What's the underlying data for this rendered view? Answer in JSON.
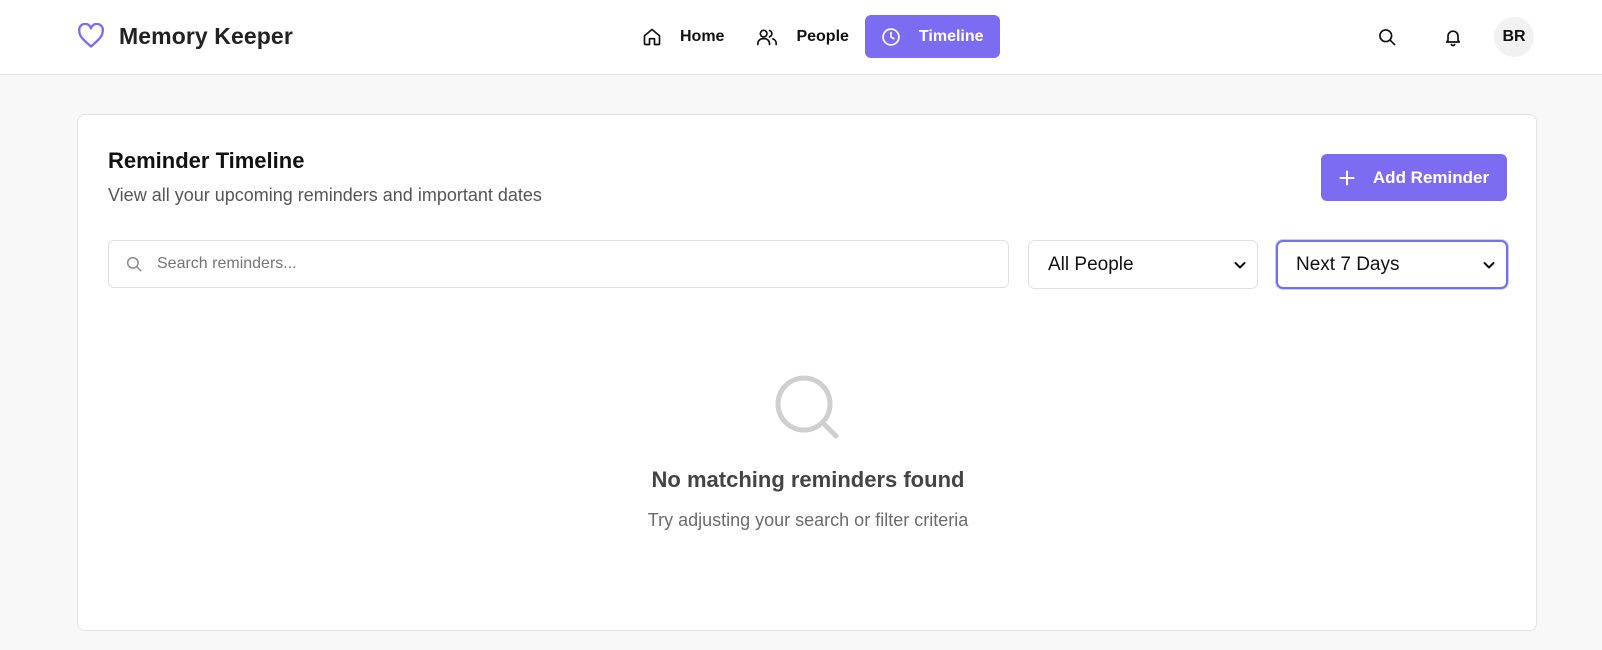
{
  "app": {
    "title": "Memory Keeper",
    "logo_icon": "heart-icon",
    "accent_color": "#7c6cf2"
  },
  "nav": {
    "items": [
      {
        "label": "Home",
        "icon": "home-icon",
        "active": false
      },
      {
        "label": "People",
        "icon": "users-icon",
        "active": false
      },
      {
        "label": "Timeline",
        "icon": "clock-icon",
        "active": true
      }
    ]
  },
  "header_actions": {
    "search_icon": "search-icon",
    "notifications_icon": "bell-icon",
    "avatar_initials": "BR"
  },
  "card": {
    "title": "Reminder Timeline",
    "subtitle": "View all your upcoming reminders and important dates",
    "add_button_label": "Add Reminder"
  },
  "filters": {
    "search_placeholder": "Search reminders...",
    "people_selected": "All People",
    "range_selected": "Next 7 Days"
  },
  "empty_state": {
    "icon": "search-icon",
    "title": "No matching reminders found",
    "subtitle": "Try adjusting your search or filter criteria"
  }
}
